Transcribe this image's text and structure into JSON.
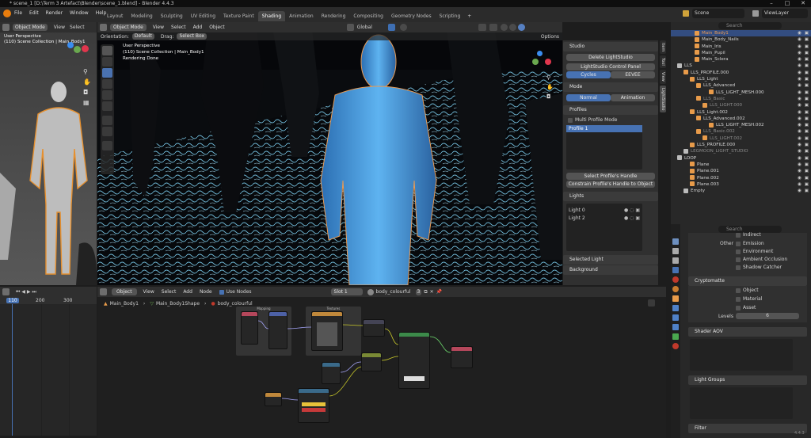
{
  "titlebar": {
    "title": "* scene_1 [D:\\Term 3 Artefact\\Blender\\scene_1.blend] - Blender 4.4.3"
  },
  "menu": [
    "File",
    "Edit",
    "Render",
    "Window",
    "Help"
  ],
  "workspaces": [
    "Layout",
    "Modeling",
    "Sculpting",
    "UV Editing",
    "Texture Paint",
    "Shading",
    "Animation",
    "Rendering",
    "Compositing",
    "Geometry Nodes",
    "Scripting"
  ],
  "active_workspace": "Shading",
  "scene": "Scene",
  "view_layer": "ViewLayer",
  "left_viewport": {
    "mode": "Object Mode",
    "view": "View",
    "select": "Select",
    "persp": "User Perspective",
    "collection": "(110) Scene Collection | Main_Body1"
  },
  "main_viewport": {
    "mode": "Object Mode",
    "menus": [
      "View",
      "Select",
      "Add",
      "Object"
    ],
    "orientation_label": "Orientation:",
    "orientation": "Default",
    "drag_label": "Drag:",
    "drag": "Select Box",
    "global": "Global",
    "options": "Options",
    "persp": "User Perspective",
    "collection": "(110) Scene Collection | Main_Body1",
    "status": "Rendering Done"
  },
  "npanel": {
    "studio": "Studio",
    "delete": "Delete LightStudio",
    "control_panel": "LightStudio Control Panel",
    "cycles": "Cycles",
    "eevee": "EEVEE",
    "mode": "Mode",
    "normal": "Normal",
    "animation": "Animation",
    "profiles": "Profiles",
    "multi_profile": "Multi Profile Mode",
    "profile1": "Profile 1",
    "select_handle": "Select Profile's Handle",
    "constrain_handle": "Constrain Profile's Handle to Object",
    "lights": "Lights",
    "light0": "Light 0",
    "light2": "Light 2",
    "selected_light": "Selected Light",
    "background": "Background",
    "tabs": [
      "Item",
      "Tool",
      "View",
      "LightStudio"
    ]
  },
  "outliner": [
    {
      "label": "Main_Body1",
      "indent": 30,
      "orange": true,
      "sel": true
    },
    {
      "label": "Main_Body_Nails",
      "indent": 30
    },
    {
      "label": "Main_Iris",
      "indent": 30
    },
    {
      "label": "Main_Pupil",
      "indent": 30
    },
    {
      "label": "Main_Sclera",
      "indent": 30
    },
    {
      "label": "LLS",
      "indent": 8
    },
    {
      "label": "LLS_PROFILE.000",
      "indent": 16
    },
    {
      "label": "LLS_Light",
      "indent": 24
    },
    {
      "label": "LLS_Advanced",
      "indent": 32
    },
    {
      "label": "LLS_LIGHT_MESH.000",
      "indent": 48
    },
    {
      "label": "LLS_Basic",
      "indent": 32,
      "dim": true
    },
    {
      "label": "LLS_LIGHT.000",
      "indent": 40,
      "dim": true
    },
    {
      "label": "LLS_Light.002",
      "indent": 24
    },
    {
      "label": "LLS_Advanced.002",
      "indent": 32
    },
    {
      "label": "LLS_LIGHT_MESH.002",
      "indent": 48
    },
    {
      "label": "LLS_Basic.002",
      "indent": 32,
      "dim": true
    },
    {
      "label": "LLS_LIGHT.002",
      "indent": 40,
      "dim": true
    },
    {
      "label": "LLS_PROFILE.000",
      "indent": 24
    },
    {
      "label": "LEGMOON_LIGHT_STUDIO",
      "indent": 16,
      "dim": true
    },
    {
      "label": "LOOP",
      "indent": 8
    },
    {
      "label": "Plane",
      "indent": 24
    },
    {
      "label": "Plane.001",
      "indent": 24
    },
    {
      "label": "Plane.002",
      "indent": 24
    },
    {
      "label": "Plane.003",
      "indent": 24
    },
    {
      "label": "Empty",
      "indent": 16
    }
  ],
  "properties": {
    "search": "Search",
    "indirect": "Indirect",
    "other": "Other",
    "emission": "Emission",
    "environment": "Environment",
    "ao": "Ambient Occlusion",
    "shadow_catcher": "Shadow Catcher",
    "cryptomatte": "Cryptomatte",
    "object": "Object",
    "material": "Material",
    "asset": "Asset",
    "levels": "Levels",
    "levels_val": "6",
    "shader_aov": "Shader AOV",
    "light_groups": "Light Groups",
    "filter": "Filter"
  },
  "timeline": {
    "frame": "110",
    "ticks": [
      "110",
      "200",
      "300"
    ]
  },
  "node_editor": {
    "object": "Object",
    "menus": [
      "View",
      "Select",
      "Add",
      "Node"
    ],
    "use_nodes": "Use Nodes",
    "slot": "Slot 1",
    "material": "body_colourful",
    "users": "3",
    "breadcrumb": [
      "Main_Body1",
      "Main_Body1Shape",
      "body_colourful"
    ],
    "mapping": "Mapping",
    "texture": "Textures"
  },
  "version": "4.4.3"
}
